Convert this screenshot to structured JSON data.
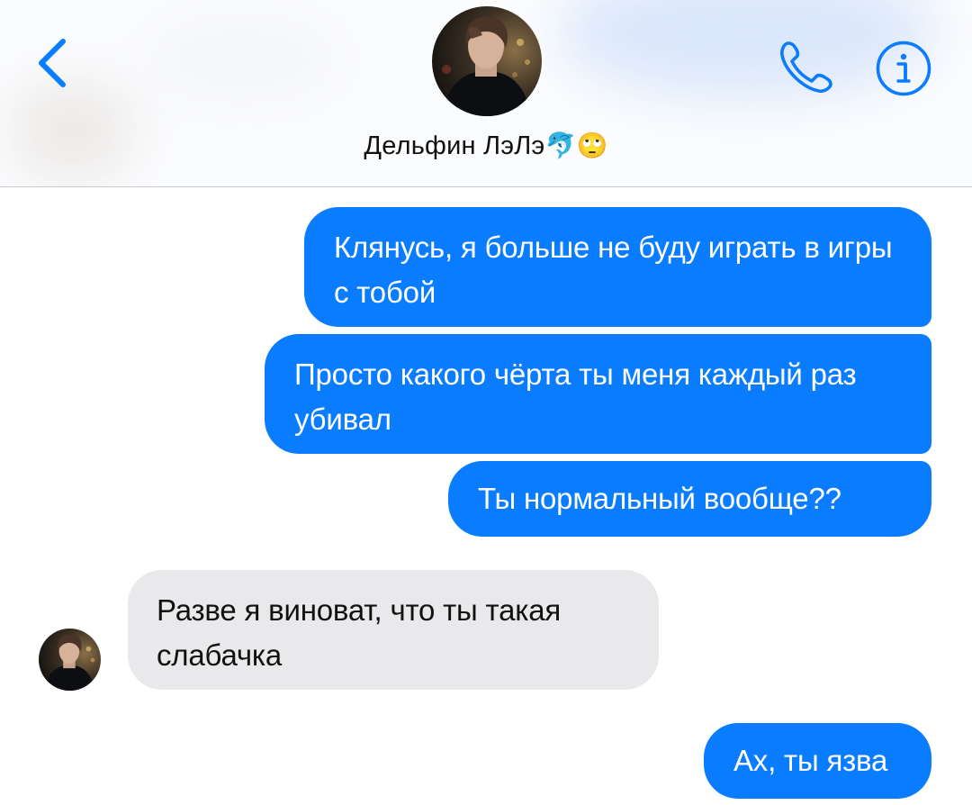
{
  "header": {
    "contact_name": "Дельфин ЛэЛэ",
    "name_emoji": "🐬🙄",
    "accent_color": "#0a7cff",
    "icons": [
      "chevron-left-icon",
      "phone-icon",
      "info-icon"
    ]
  },
  "messages": [
    {
      "direction": "outgoing",
      "text": "Клянусь, я больше не буду играть в игры с тобой"
    },
    {
      "direction": "outgoing",
      "text": "Просто какого чёрта ты меня каждый раз убивал"
    },
    {
      "direction": "outgoing",
      "text": "Ты нормальный вообще??"
    },
    {
      "direction": "incoming",
      "text": "Разве я виноват, что ты такая слабачка"
    },
    {
      "direction": "outgoing",
      "text": "Ах, ты язва"
    }
  ],
  "colors": {
    "outgoing_bubble": "#0a7cff",
    "incoming_bubble": "#e9e9eb",
    "outgoing_text": "#ffffff",
    "incoming_text": "#111111"
  }
}
